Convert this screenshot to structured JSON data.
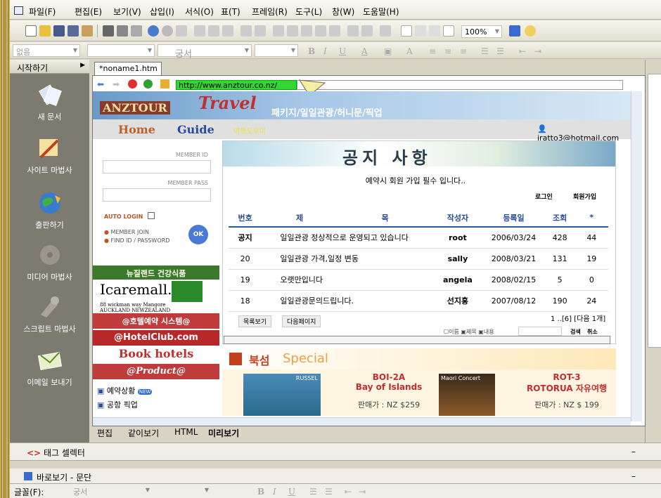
{
  "menu": [
    "파일(F)",
    "편집(E)",
    "보기(V)",
    "삽입(I)",
    "서식(O)",
    "표(T)",
    "프레임(R)",
    "도구(L)",
    "창(W)",
    "도움말(H)"
  ],
  "toolbar": {
    "zoom": "100%"
  },
  "format": {
    "style": "없음",
    "font": "궁서"
  },
  "sidebar": {
    "start_label": "시작하기",
    "items": [
      "새 문서",
      "사이트 마법사",
      "출판하기",
      "미디어 마법사",
      "스크립트 마법사",
      "이메일 보내기"
    ]
  },
  "tab": {
    "name": "*noname1.htm"
  },
  "browser": {
    "url": "http://www.anztour.co.nz/"
  },
  "site": {
    "logo": "ANZTOUR",
    "banner_text": "패키지/일일관광/허니문/픽업",
    "home": "Home",
    "guide": "Guide",
    "guide_sub": "여행도우미",
    "email": "iratto3@hotmail.com",
    "member_id": "MEMBER ID",
    "member_pass": "MEMBER PASS",
    "auto_login": "AUTO LOGIN",
    "member_join": "MEMBER JOIN",
    "find_id": "FIND ID / PASSWORD",
    "ok": "OK",
    "ad_nz": "뉴질랜드 건강식품",
    "ad_icaremall": "Icaremall.com",
    "ad_addr1": "88 wickman way Mangore",
    "ad_addr2": "AUCKLAND NEWZEALAND",
    "hotel_booking": "@호텔예약 시스템@",
    "hotelclub": "@HotelClub.com",
    "book_hotels": "Book hotels",
    "product": "@Product@",
    "links": [
      "예약상황",
      "공항 픽업"
    ],
    "new_badge": "NEW"
  },
  "notice": {
    "title": "공지 사항",
    "message": "예약시 회원 가입 필수 입니다..",
    "login": "로그인",
    "signup": "회원가입",
    "columns": [
      "번호",
      "제",
      "목",
      "작성자",
      "등록일",
      "조회",
      "*"
    ],
    "rows": [
      [
        "공지",
        "일일관광 정상적으로 운영되고 있습니다",
        "root",
        "2006/03/24",
        "428",
        "44"
      ],
      [
        "20",
        "일일관광 가격,일정 변동",
        "sally",
        "2008/03/21",
        "131",
        "19"
      ],
      [
        "19",
        "오랫만입니다",
        "angela",
        "2008/02/15",
        "5",
        "0"
      ],
      [
        "18",
        "일일관광문의드립니다.",
        "선지홍",
        "2007/08/12",
        "190",
        "24"
      ]
    ],
    "list_btn": "목록보기",
    "next_btn": "다음페이지",
    "pager": "1 ..[6] [다음 1개]",
    "search_opts": [
      "이름",
      "제목",
      "내용"
    ],
    "search_btn": "검색",
    "cancel_btn": "취소"
  },
  "special": {
    "title": "북섬",
    "title_en": "Special",
    "item1_code": "BOI-2A",
    "item1_name": "Bay of Islands",
    "item1_price": "판매가 : NZ $259",
    "item1_img": "RUSSEL",
    "item2_img": "Maori Concert",
    "item3_code": "ROT-3",
    "item3_name": "ROTORUA 자유여행",
    "item3_price": "판매가 : NZ $ 199"
  },
  "view_tabs": [
    "편집",
    "같이보기",
    "HTML",
    "미리보기"
  ],
  "tag_selector": "태그 셀렉터",
  "quick_view": "바로보기 - 문단",
  "font_label": "글꼴(F):",
  "font_value": "궁서"
}
